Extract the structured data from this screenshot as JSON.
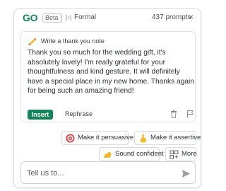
{
  "header": {
    "logo": "GO",
    "badge": "Beta",
    "tone_label": "Formal",
    "prompts_count": "437 prompts",
    "close_glyph": "×"
  },
  "card": {
    "request_icon": "writing-hand-icon",
    "request_text": "Write a thank you note",
    "body": "Thank you so much for the wedding gift, it's absolutely lovely! I'm really grateful for your thoughtfulness and kind gesture. It will definitely have a special place in my new home. Thanks again for being such an amazing friend!",
    "insert_label": "Insert",
    "rephrase_label": "Rephrase",
    "action_icons": [
      "trash-icon",
      "flag-icon"
    ]
  },
  "chips": {
    "persuasive": {
      "label": "Make it persuasive",
      "icon": "target-icon"
    },
    "assertive": {
      "label": "Make it assertive",
      "icon": "hand-pointing-icon"
    },
    "confident": {
      "label": "Sound confident",
      "icon": "flexed-arm-icon"
    },
    "more": {
      "label": "More",
      "icon": "grid-plus-icon"
    }
  },
  "input": {
    "placeholder": "Tell us to...",
    "value": "",
    "send_icon": "send-icon"
  },
  "colors": {
    "brand_green": "#15845a",
    "border": "#d7dbe0",
    "text": "#2b2f33"
  }
}
